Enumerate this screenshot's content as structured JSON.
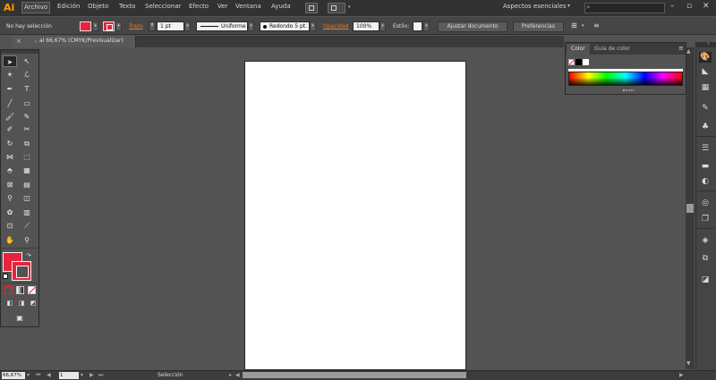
{
  "app": {
    "logo": "Ai",
    "menu": [
      "Archivo",
      "Edición",
      "Objeto",
      "Texto",
      "Seleccionar",
      "Efecto",
      "Ver",
      "Ventana",
      "Ayuda"
    ],
    "workspace": "Aspectos esenciales",
    "search_placeholder": "",
    "window_controls": [
      "–",
      "▫",
      "✕"
    ]
  },
  "control_bar": {
    "selection_status": "No hay selección",
    "stroke_label": "Trazo",
    "stroke_weight": "1 pt",
    "stroke_profile": "Uniforme",
    "brush": "Redondo 5 pt.",
    "opacity_label": "Opacidad",
    "opacity_value": "100%",
    "style_label": "Estilo:",
    "adjust_doc_button": "Ajustar documento",
    "preferences_button": "Preferencias",
    "fill_color": "#e8233b",
    "stroke_color": "#e8233b"
  },
  "document": {
    "tab_close": "×",
    "tab_label": "al 66,67% (CMYK/Previsualizar)"
  },
  "color_panel": {
    "tab_color": "Color",
    "tab_guide": "Guía de color",
    "menu_icon": "≡"
  },
  "status_bar": {
    "zoom": "66,67%",
    "page": "1",
    "tool_name": "Selección"
  },
  "colors": {
    "accent": "#ff9a00",
    "fill": "#e8233b",
    "panel_bg": "#535353",
    "menubar_bg": "#323232"
  }
}
